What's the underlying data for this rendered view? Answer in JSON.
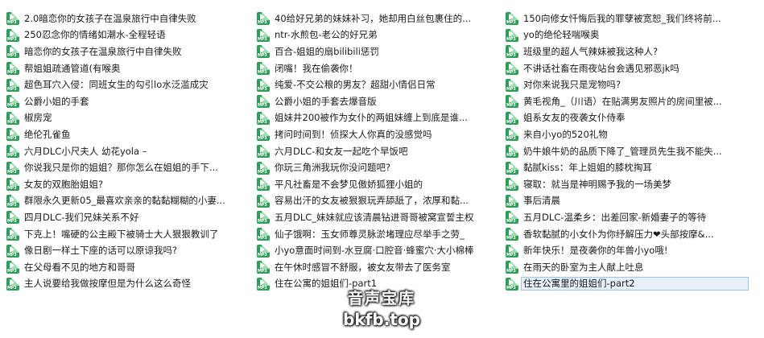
{
  "file_icon": {
    "name": "mp3-audio-file-icon",
    "ext": "MP3",
    "color": "#2f9d57"
  },
  "columns": [
    {
      "items": [
        "2.0暗恋你的女孩子在温泉旅行中自律失败",
        "250忍念你的情绪如潮水-全程轻语",
        "暗恋你的女孩子在温泉旅行中自律失败",
        "帮姐姐疏通管道(有喉奥",
        "超色耳穴入侵：同班女生的勾引lo水泛滥成灾",
        "公爵小姐的手套",
        "椒房宠",
        "绝伦孔雀鱼",
        "六月DLC小尺夫人 幼花yola –",
        "你说我只是你的姐姐？那你怎么在姐姐的手下...",
        "女友的双胞胎姐姐?",
        "群限永久更新05_最喜欢亲亲的黏黏糊糊的小妻...",
        "四月DLC-我们兄妹关系不好",
        "下克上！嘴硬的公主殿下被骑士大人狠狠教训了",
        "像日剧一样土下座的话可以原谅我吗?",
        "在父母看不见的地方和哥哥",
        "主人说要给我做按摩但是为什么这么奇怪"
      ]
    },
    {
      "items": [
        "40给好兄弟的妹妹补习，她却用白丝包裹住的...",
        "ntr-水煎包-老公的好兄弟",
        "百合-姐姐的扇bilibili惩罚",
        "闭嘴！我在偷袭你！",
        "纯爱-不交公粮的男友？超甜小情侣日常",
        "公爵小姐的手套去爆音版",
        "姐妹井200被作为女仆的两姐妹缠上到底是谁...",
        "拷问时间到！侦探大人你真的没感觉吗",
        "六月DLC-和女友一起吃个早饭吧",
        "你玩三角洲我玩你没问题吧?",
        "平凡社畜是不会梦见傲娇狐狸小姐的",
        "容易出汗的女友被狠狠玩弄舔舐了，浓厚和黏...",
        "五月DLC_妹妹就应该清晨钻进哥哥被窝宣誓主权",
        "仙子饿啊：玉女师尊灵脉淤堵理应尽举手之劳_",
        "小yo意面时间到-水豆腐·口腔音·蜂蜜穴·大小棉棒",
        "在午休时感冒不舒服，被女友带去了医务室",
        "住在公寓的姐姐们-part1"
      ]
    },
    {
      "items": [
        "150向修女忏悔后我的罪孽被宽恕_我们终将前...",
        "yo的绝伦轻喘喉奥",
        "班级里的超人气辣妹被我这种人?",
        "不讲话社畜在雨夜站台会遇见邪恶jk吗",
        "对你来说我只是宠物吗?",
        "黄毛视角_（川语）在贴满男友照片的房间里被...",
        "姐系女友的夜袭女仆侍奉",
        "来自小yo的520礼物",
        "奶牛娘牛奶的品质下降了_管理员先生我不能失...",
        "黏腻kiss：年上姐姐的膝枕掏耳",
        "寝取：就当是神明赐予我的一场美梦",
        "事后清晨",
        "五月DLC-温柔乡：出差回家-新婚妻子的等待",
        "香软黏腻的小女仆为你纾解压力❤头部按摩&...",
        "新年快乐！是夜袭你的年兽小yo哦!",
        "在雨天的卧室为主人献上吐息",
        "住在公寓里的姐姐们-part2"
      ]
    }
  ],
  "selected": {
    "column": 2,
    "index": 16
  },
  "watermark": {
    "line1": "音声宝库",
    "line2": "bkfb.top"
  }
}
